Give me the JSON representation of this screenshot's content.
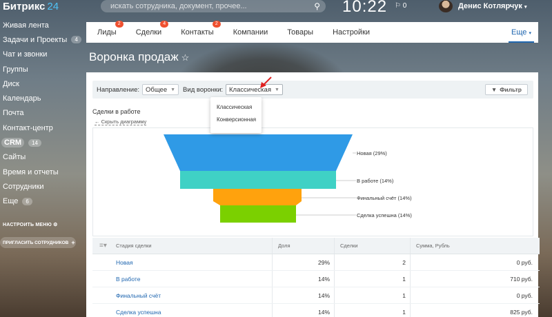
{
  "header": {
    "logo_text": "Битрикс",
    "logo_num": "24",
    "search_placeholder": "искать сотрудника, документ, прочее...",
    "clock": "10:22",
    "flag": "⚐ 0",
    "username": "Денис Котлярчук"
  },
  "leftmenu": {
    "items": [
      {
        "label": "Живая лента",
        "badge": ""
      },
      {
        "label": "Задачи и Проекты",
        "badge": "4"
      },
      {
        "label": "Чат и звонки",
        "badge": ""
      },
      {
        "label": "Группы",
        "badge": ""
      },
      {
        "label": "Диск",
        "badge": ""
      },
      {
        "label": "Календарь",
        "badge": ""
      },
      {
        "label": "Почта",
        "badge": ""
      },
      {
        "label": "Контакт-центр",
        "badge": ""
      },
      {
        "label": "CRM",
        "badge": "14"
      },
      {
        "label": "Сайты",
        "badge": ""
      },
      {
        "label": "Время и отчеты",
        "badge": ""
      },
      {
        "label": "Сотрудники",
        "badge": ""
      },
      {
        "label": "Еще",
        "badge": "6"
      }
    ],
    "configure": "НАСТРОИТЬ МЕНЮ",
    "invite": "ПРИГЛАСИТЬ СОТРУДНИКОВ"
  },
  "tabs": {
    "items": [
      {
        "label": "Лиды",
        "badge": "2"
      },
      {
        "label": "Сделки",
        "badge": "4"
      },
      {
        "label": "Контакты",
        "badge": "2"
      },
      {
        "label": "Компании",
        "badge": ""
      },
      {
        "label": "Товары",
        "badge": ""
      },
      {
        "label": "Настройки",
        "badge": ""
      }
    ],
    "more": "Еще"
  },
  "page": {
    "title": "Воронка продаж"
  },
  "filter": {
    "direction_label": "Направление:",
    "direction_value": "Общее",
    "type_label": "Вид воронки:",
    "type_value": "Классическая",
    "filter_button": "Фильтр",
    "options": [
      "Классическая",
      "Конверсионная"
    ]
  },
  "section": {
    "title": "Сделки в работе",
    "hide_link": "Скрыть диаграмму"
  },
  "funnel": {
    "stages": [
      {
        "label": "Новая (29%)",
        "color": "#2f9ae6"
      },
      {
        "label": "В работе (14%)",
        "color": "#3fd1c5"
      },
      {
        "label": "Финальный счёт (14%)",
        "color": "#ffa20d"
      },
      {
        "label": "Сделка успешна (14%)",
        "color": "#7bd000"
      }
    ]
  },
  "table": {
    "headers": [
      "Стадия сделки",
      "Доля",
      "Сделки",
      "Сумма, Рубль"
    ],
    "rows": [
      [
        "Новая",
        "29%",
        "2",
        "0 руб."
      ],
      [
        "В работе",
        "14%",
        "1",
        "710 руб."
      ],
      [
        "Финальный счёт",
        "14%",
        "1",
        "0 руб."
      ],
      [
        "Сделка успешна",
        "14%",
        "1",
        "825 руб."
      ]
    ]
  }
}
